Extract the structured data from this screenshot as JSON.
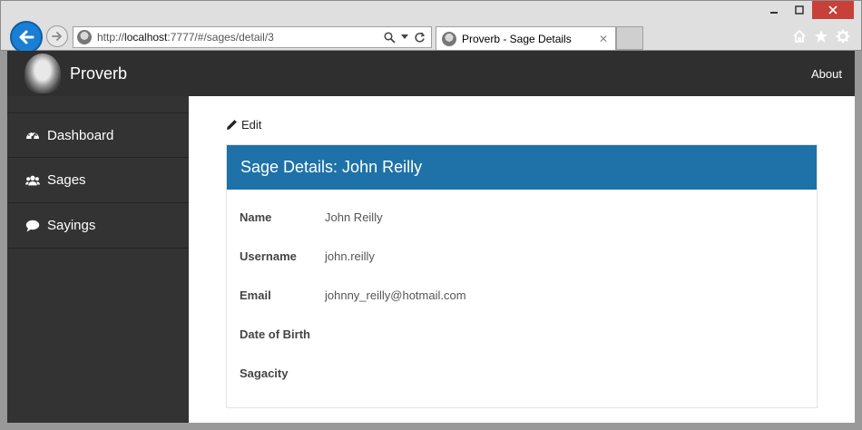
{
  "browser": {
    "url_prefix": "http://",
    "url_host": "localhost",
    "url_rest": ":7777/#/sages/detail/3",
    "tab_title": "Proverb - Sage Details",
    "icons": [
      "back-arrow-icon",
      "forward-arrow-icon",
      "search-icon",
      "dropdown-icon",
      "refresh-icon",
      "home-icon",
      "star-icon",
      "gear-icon"
    ]
  },
  "navbar": {
    "brand": "Proverb",
    "about": "About"
  },
  "sidebar": {
    "items": [
      {
        "label": "Dashboard",
        "icon": "dashboard-icon"
      },
      {
        "label": "Sages",
        "icon": "users-icon"
      },
      {
        "label": "Sayings",
        "icon": "comment-icon"
      }
    ]
  },
  "main": {
    "edit_label": "Edit",
    "panel_title": "Sage Details: John Reilly",
    "fields": [
      {
        "label": "Name",
        "value": "John Reilly"
      },
      {
        "label": "Username",
        "value": "john.reilly"
      },
      {
        "label": "Email",
        "value": "johnny_reilly@hotmail.com"
      },
      {
        "label": "Date of Birth",
        "value": ""
      },
      {
        "label": "Sagacity",
        "value": ""
      }
    ]
  },
  "colors": {
    "navbar": "#2f2f2f",
    "sidebar": "#333333",
    "panel_header": "#1e72a7",
    "back_button": "#1a7fd4",
    "close_button": "#c7403a"
  }
}
